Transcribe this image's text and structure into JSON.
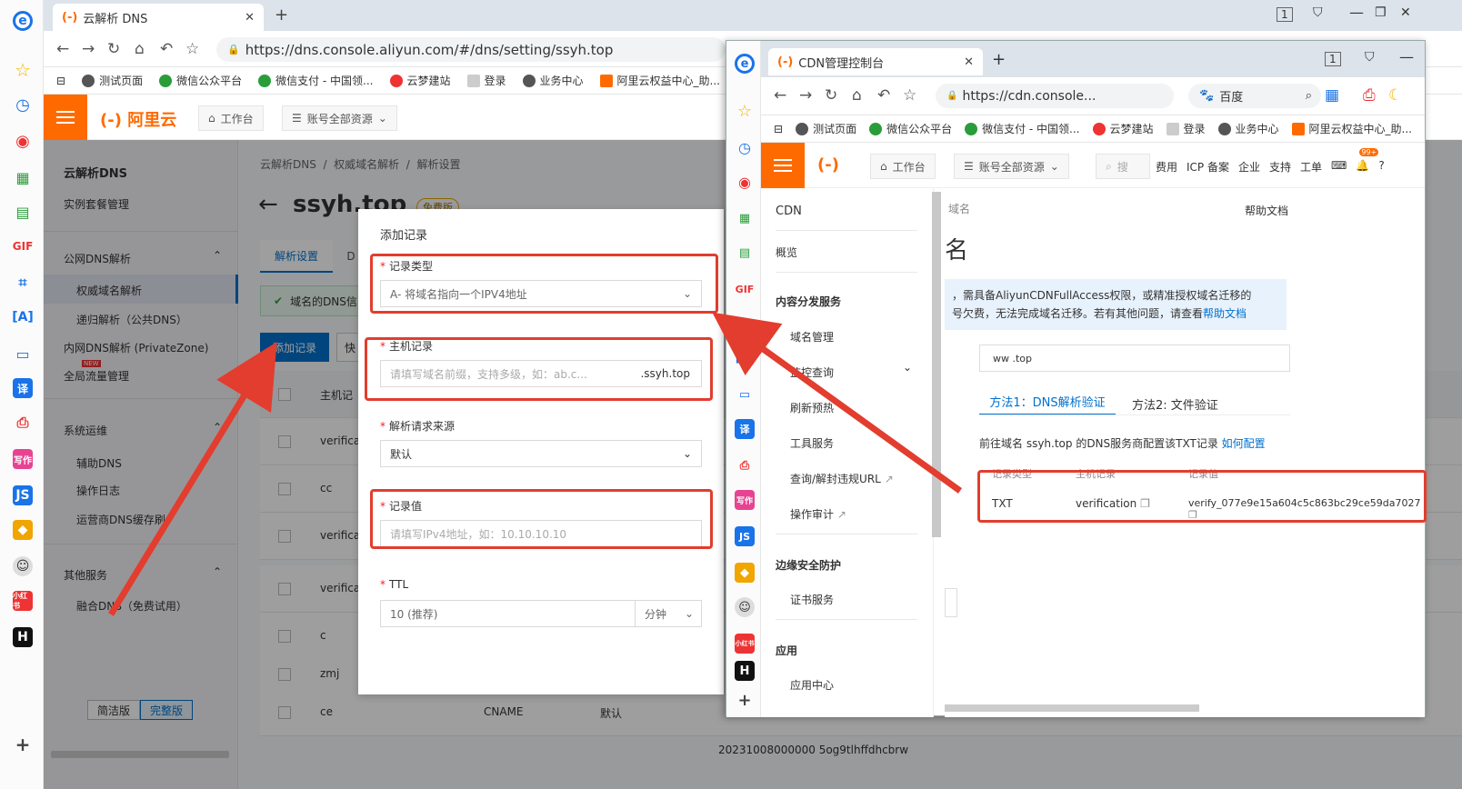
{
  "win1": {
    "tab_title": "云解析 DNS",
    "tab_logo": "(-)",
    "url": "https://dns.console.aliyun.com/#/dns/setting/ssyh.top",
    "bookmarks": [
      "测试页面",
      "微信公众平台",
      "微信支付 - 中国领...",
      "云梦建站",
      "登录",
      "业务中心",
      "阿里云权益中心_助..."
    ],
    "logo_text": "(-) 阿里云",
    "nav_workbench": "工作台",
    "nav_resources": "账号全部资源",
    "sidebar": {
      "title": "云解析DNS",
      "instance": "实例套餐管理",
      "public_dns": "公网DNS解析",
      "authoritative": "权威域名解析",
      "recursive": "递归解析（公共DNS）",
      "private_zone": "内网DNS解析 (PrivateZone)",
      "new_badge": "NEW",
      "gtm": "全局流量管理",
      "ops": "系统运维",
      "aux_dns": "辅助DNS",
      "oplog": "操作日志",
      "isp_cache": "运营商DNS缓存刷",
      "other": "其他服务",
      "fusion": "融合DNS（免费试用）",
      "simple": "简洁版",
      "full": "完整版"
    },
    "breadcrumb": [
      "云解析DNS",
      "权威域名解析",
      "解析设置"
    ],
    "domain_title": "ssyh.top",
    "edition_badge": "免费版",
    "tab_settings": "解析设置",
    "tab_d": "D",
    "notice": "域名的DNS信",
    "add_record_btn": "添加记录",
    "quick_btn": "快",
    "table_header": "主机记",
    "rows": [
      "verificat",
      "cc",
      "verificat",
      "verificat",
      "c",
      "zmj",
      "ce"
    ],
    "row_last_type": "CNAME",
    "row_last_line": "默认",
    "bottom_value": "20231008000000 5og9tlhffdhcbrw"
  },
  "modal": {
    "title": "添加记录",
    "type_label": "记录类型",
    "type_value": "A- 将域名指向一个IPV4地址",
    "host_label": "主机记录",
    "host_placeholder": "请填写域名前缀，支持多级，如：ab.c...",
    "host_suffix": ".ssyh.top",
    "line_label": "解析请求来源",
    "line_value": "默认",
    "value_label": "记录值",
    "value_placeholder": "请填写IPv4地址，如：10.10.10.10",
    "ttl_label": "TTL",
    "ttl_value": "10 (推荐)",
    "ttl_unit": "分钟"
  },
  "win2": {
    "tab_title": "CDN管理控制台",
    "url": "https://cdn.console...",
    "search_engine": "百度",
    "bookmarks": [
      "测试页面",
      "微信公众平台",
      "微信支付 - 中国领...",
      "云梦建站",
      "登录",
      "业务中心",
      "阿里云权益中心_助..."
    ],
    "nav_workbench": "工作台",
    "nav_resources": "账号全部资源",
    "search_placeholder": "搜",
    "top_links": [
      "费用",
      "ICP 备案",
      "企业",
      "支持",
      "工单"
    ],
    "badge": "99+",
    "sidebar": {
      "title": "CDN",
      "overview": "概览",
      "content_dist": "内容分发服务",
      "domain_mgmt": "域名管理",
      "monitor": "监控查询",
      "refresh": "刷新预热",
      "tools": "工具服务",
      "query_block": "查询/解封违规URL",
      "audit": "操作审计",
      "edge_sec": "边缘安全防护",
      "cert": "证书服务",
      "app": "应用",
      "app_center": "应用中心"
    },
    "crumb_tail": "域名",
    "help_doc": "帮助文档",
    "big_char": "名",
    "info_line1": "，需具备AliyunCDNFullAccess权限，或精准授权域名迁移的",
    "info_line2": "号欠费，无法完成域名迁移。若有其他问题，请查看",
    "info_link": "帮助文档",
    "domain_field": "ww  .top",
    "method1": "方法1：DNS解析验证",
    "method2": "方法2: 文件验证",
    "instruction": "前往域名 ssyh.top 的DNS服务商配置该TXT记录",
    "how_link": "如何配置",
    "table_headers": [
      "记录类型",
      "主机记录",
      "记录值"
    ],
    "txt_type": "TXT",
    "txt_host": "verification",
    "txt_value": "verify_077e9e15a604c5c863bc29ce59da7027"
  },
  "colors": {
    "aliyun_orange": "#ff6a00",
    "primary_blue": "#0070cc",
    "annotation_red": "#e23d2e"
  }
}
